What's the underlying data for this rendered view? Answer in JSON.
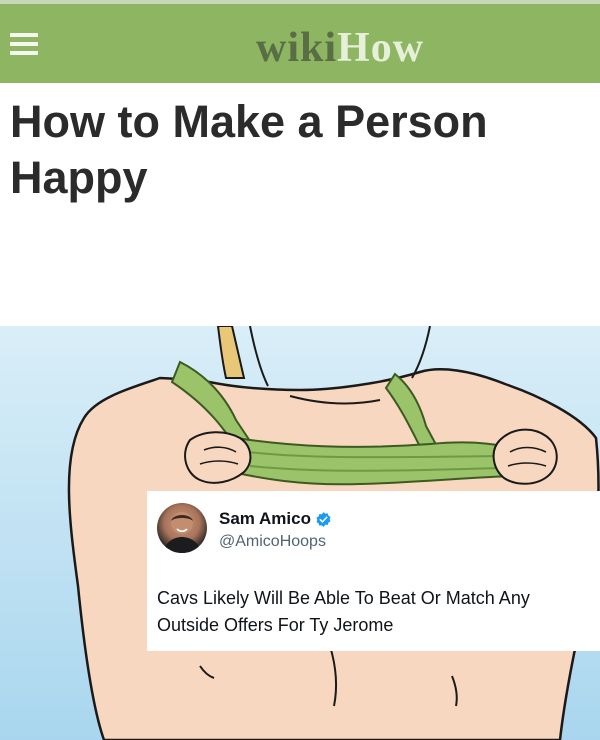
{
  "header": {
    "logo_wiki": "wiki",
    "logo_how": "How",
    "menu_icon": "hamburger-menu-icon",
    "background_color": "#8db562"
  },
  "article": {
    "title": "How to Make a Person Happy"
  },
  "tweet": {
    "author_name": "Sam Amico",
    "author_handle": "@AmicoHoops",
    "verified_icon": "verified-badge-icon",
    "verified_color": "#1d9bf0",
    "text": "Cavs Likely Will Be Able To Beat Or Match Any Outside Offers For Ty Jerome"
  }
}
